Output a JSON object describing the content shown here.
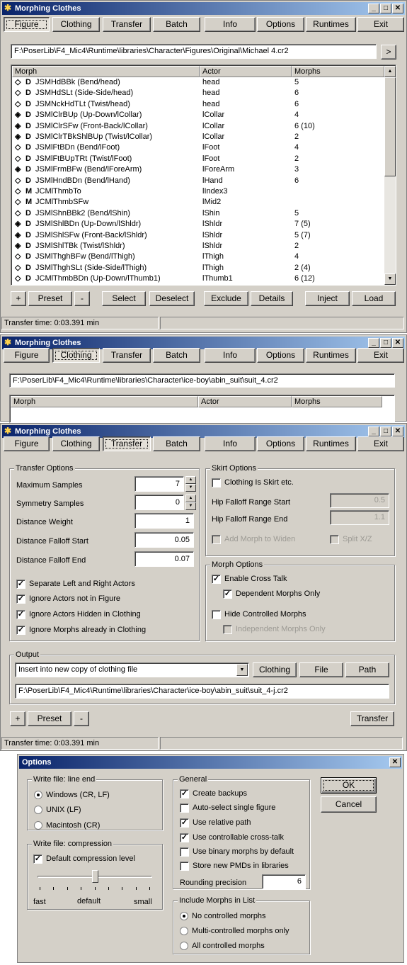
{
  "app": {
    "title": "Morphing Clothes",
    "min_glyph": "_",
    "max_glyph": "□",
    "close_glyph": "✕",
    "tabs": [
      "Figure",
      "Clothing",
      "Transfer",
      "Batch",
      "Info",
      "Options",
      "Runtimes",
      "Exit"
    ]
  },
  "figure_panel": {
    "path": "F:\\PoserLib\\F4_Mic4\\Runtime\\libraries\\Character\\Figures\\Original\\Michael 4.cr2",
    "browse_label": ">",
    "columns": [
      "Morph",
      "Actor",
      "Morphs"
    ],
    "rows": [
      {
        "icon": "◇",
        "type": "D",
        "morph": "JSMHdBBk (Bend/head)",
        "actor": "head",
        "morphs": "5"
      },
      {
        "icon": "◇",
        "type": "D",
        "morph": "JSMHdSLt (Side-Side/head)",
        "actor": "head",
        "morphs": "6"
      },
      {
        "icon": "◇",
        "type": "D",
        "morph": "JSMNckHdTLt (Twist/head)",
        "actor": "head",
        "morphs": "6"
      },
      {
        "icon": "◈",
        "type": "D",
        "morph": "JSMlClrBUp (Up-Down/lCollar)",
        "actor": "lCollar",
        "morphs": "4"
      },
      {
        "icon": "◈",
        "type": "D",
        "morph": "JSMlClrSFw (Front-Back/lCollar)",
        "actor": "lCollar",
        "morphs": "6 (10)"
      },
      {
        "icon": "◈",
        "type": "D",
        "morph": "JSMlClrTBkShlBUp (Twist/lCollar)",
        "actor": "lCollar",
        "morphs": "2"
      },
      {
        "icon": "◇",
        "type": "D",
        "morph": "JSMlFtBDn (Bend/lFoot)",
        "actor": "lFoot",
        "morphs": "4"
      },
      {
        "icon": "◇",
        "type": "D",
        "morph": "JSMlFtBUpTRt (Twist/lFoot)",
        "actor": "lFoot",
        "morphs": "2"
      },
      {
        "icon": "◈",
        "type": "D",
        "morph": "JSMlFrmBFw (Bend/lForeArm)",
        "actor": "lForeArm",
        "morphs": "3"
      },
      {
        "icon": "◇",
        "type": "D",
        "morph": "JSMlHndBDn (Bend/lHand)",
        "actor": "lHand",
        "morphs": "6"
      },
      {
        "icon": "◇",
        "type": "M",
        "morph": "JCMlThmbTo",
        "actor": "lIndex3",
        "morphs": ""
      },
      {
        "icon": "◇",
        "type": "M",
        "morph": "JCMlThmbSFw",
        "actor": "lMid2",
        "morphs": ""
      },
      {
        "icon": "◇",
        "type": "D",
        "morph": "JSMlShnBBk2 (Bend/lShin)",
        "actor": "lShin",
        "morphs": "5"
      },
      {
        "icon": "◈",
        "type": "D",
        "morph": "JSMlShlBDn (Up-Down/lShldr)",
        "actor": "lShldr",
        "morphs": "7 (5)"
      },
      {
        "icon": "◈",
        "type": "D",
        "morph": "JSMlShlSFw (Front-Back/lShldr)",
        "actor": "lShldr",
        "morphs": "5 (7)"
      },
      {
        "icon": "◈",
        "type": "D",
        "morph": "JSMlShlTBk (Twist/lShldr)",
        "actor": "lShldr",
        "morphs": "2"
      },
      {
        "icon": "◇",
        "type": "D",
        "morph": "JSMlThghBFw (Bend/lThigh)",
        "actor": "lThigh",
        "morphs": "4"
      },
      {
        "icon": "◇",
        "type": "D",
        "morph": "JSMlThghSLt (Side-Side/lThigh)",
        "actor": "lThigh",
        "morphs": "2 (4)"
      },
      {
        "icon": "◇",
        "type": "D",
        "morph": "JCMlThmbBDn (Up-Down/lThumb1)",
        "actor": "lThumb1",
        "morphs": "6 (12)"
      }
    ],
    "buttons": {
      "plus": "+",
      "preset": "Preset",
      "minus": "-",
      "select": "Select",
      "deselect": "Deselect",
      "exclude": "Exclude",
      "details": "Details",
      "inject": "Inject",
      "load": "Load"
    },
    "status": "Transfer time: 0:03.391 min"
  },
  "clothing_panel": {
    "path": "F:\\PoserLib\\F4_Mic4\\Runtime\\libraries\\Character\\ice-boy\\abin_suit\\suit_4.cr2",
    "columns": [
      "Morph",
      "Actor",
      "Morphs"
    ]
  },
  "transfer_panel": {
    "transfer_options_label": "Transfer Options",
    "max_samples_label": "Maximum Samples",
    "max_samples": "7",
    "sym_samples_label": "Symmetry Samples",
    "sym_samples": "0",
    "dist_weight_label": "Distance Weight",
    "dist_weight": "1",
    "dist_falloff_start_label": "Distance Falloff Start",
    "dist_falloff_start": "0.05",
    "dist_falloff_end_label": "Distance Falloff End",
    "dist_falloff_end": "0.07",
    "sep_lr_label": "Separate Left and Right Actors",
    "ignore_not_in_fig_label": "Ignore Actors not in Figure",
    "ignore_hidden_label": "Ignore Actors Hidden in Clothing",
    "ignore_morphs_label": "Ignore Morphs already in Clothing",
    "skirt_options_label": "Skirt Options",
    "clothing_skirt_label": "Clothing Is Skirt etc.",
    "hip_start_label": "Hip Falloff Range Start",
    "hip_start": "0.5",
    "hip_end_label": "Hip Falloff Range End",
    "hip_end": "1.1",
    "add_morph_widen_label": "Add Morph to Widen",
    "split_xz_label": "Split X/Z",
    "morph_options_label": "Morph Options",
    "enable_cross_talk_label": "Enable Cross Talk",
    "dependent_morphs_label": "Dependent Morphs Only",
    "hide_controlled_label": "Hide Controlled Morphs",
    "independent_morphs_label": "Independent Morphs Only",
    "output_label": "Output",
    "output_mode": "Insert into new copy of clothing file",
    "clothing_btn": "Clothing",
    "file_btn": "File",
    "path_btn": "Path",
    "output_path": "F:\\PoserLib\\F4_Mic4\\Runtime\\libraries\\Character\\ice-boy\\abin_suit\\suit_4-j.cr2",
    "plus": "+",
    "preset": "Preset",
    "minus": "-",
    "transfer_btn": "Transfer",
    "status": "Transfer time: 0:03.391 min"
  },
  "options_dialog": {
    "title": "Options",
    "close_glyph": "✕",
    "line_end_label": "Write file: line end",
    "windows_label": "Windows (CR, LF)",
    "unix_label": "UNIX (LF)",
    "mac_label": "Macintosh (CR)",
    "compression_label": "Write file: compression",
    "default_compression_label": "Default compression level",
    "fast_label": "fast",
    "default_label": "default",
    "small_label": "small",
    "compression_level": 0.5,
    "general_label": "General",
    "create_backups_label": "Create backups",
    "auto_select_label": "Auto-select single figure",
    "relative_path_label": "Use relative path",
    "controllable_label": "Use controllable cross-talk",
    "binary_morphs_label": "Use binary morphs by default",
    "store_pmds_label": "Store new PMDs in libraries",
    "rounding_label": "Rounding precision",
    "rounding_value": "6",
    "include_label": "Include Morphs in List",
    "no_controlled_label": "No controlled morphs",
    "multi_controlled_label": "Multi-controlled morphs only",
    "all_controlled_label": "All controlled morphs",
    "ok_label": "OK",
    "cancel_label": "Cancel",
    "check_mark": "✓"
  }
}
